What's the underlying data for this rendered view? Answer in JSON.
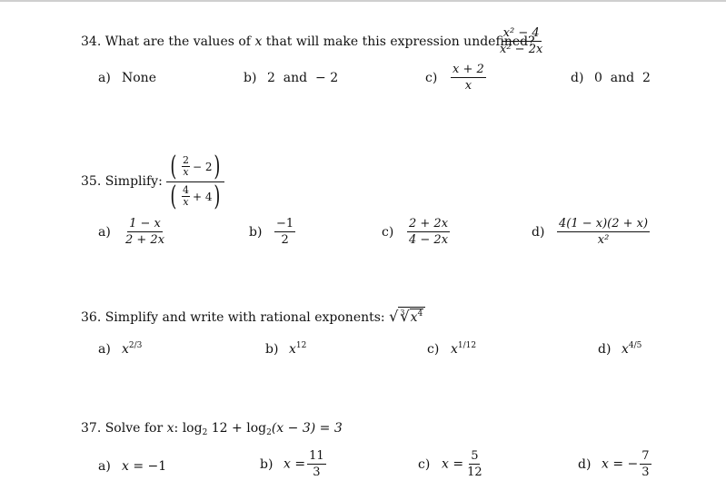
{
  "questions": [
    {
      "number": "34.",
      "prompt": "What are the values of",
      "var": "x",
      "prompt_rest": "that will make this expression undefined?",
      "expression": {
        "numerator": "x² − 4",
        "denominator": "x² − 2x"
      },
      "options": [
        {
          "label": "a)",
          "text": "None"
        },
        {
          "label": "b)",
          "text": "2  and  − 2"
        },
        {
          "label": "c)",
          "numerator": "x + 2",
          "denominator": "x"
        },
        {
          "label": "d)",
          "text": "0  and  2"
        }
      ]
    },
    {
      "number": "35.",
      "prompt": "Simplify:",
      "expression": {
        "top": {
          "frac_num": "2",
          "frac_den": "x",
          "rest": "− 2"
        },
        "bottom": {
          "frac_num": "4",
          "frac_den": "x",
          "rest": "+ 4"
        }
      },
      "options": [
        {
          "label": "a)",
          "numerator": "1 − x",
          "denominator": "2 + 2x"
        },
        {
          "label": "b)",
          "numerator": "−1",
          "denominator": "2"
        },
        {
          "label": "c)",
          "numerator": "2 + 2x",
          "denominator": "4 − 2x"
        },
        {
          "label": "d)",
          "numerator": "4(1 − x)(2 + x)",
          "denominator": "x²"
        }
      ]
    },
    {
      "number": "36.",
      "prompt": "Simplify and write with rational exponents:",
      "expression": {
        "root_index": "3",
        "base": "x",
        "power": "4"
      },
      "options": [
        {
          "label": "a)",
          "base": "x",
          "exp": "2/3"
        },
        {
          "label": "b)",
          "base": "x",
          "exp": "12"
        },
        {
          "label": "c)",
          "base": "x",
          "exp": "1/12"
        },
        {
          "label": "d)",
          "base": "x",
          "exp": "4/5"
        }
      ]
    },
    {
      "number": "37.",
      "prompt": "Solve for",
      "var": "x",
      "colon": ":",
      "expression": {
        "log1": "log",
        "base1": "2",
        "arg1": "12",
        "plus": "+",
        "log2": "log",
        "base2": "2",
        "arg2": "(x − 3) = 3"
      },
      "options": [
        {
          "label": "a)",
          "lhs": "x =",
          "text": "−1"
        },
        {
          "label": "b)",
          "lhs": "x =",
          "numerator": "11",
          "denominator": "3"
        },
        {
          "label": "c)",
          "lhs": "x =",
          "numerator": "5",
          "denominator": "12"
        },
        {
          "label": "d)",
          "lhs": "x = −",
          "numerator": "7",
          "denominator": "3"
        }
      ]
    }
  ]
}
